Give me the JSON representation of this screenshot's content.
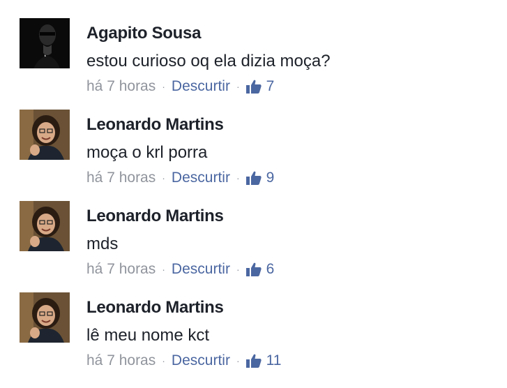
{
  "colors": {
    "text": "#1d2129",
    "meta_gray": "#90949c",
    "link_blue": "#4b67a1"
  },
  "comments": [
    {
      "author": "Agapito Sousa",
      "text": "estou curioso oq ela dizia moça?",
      "time": "há 7 horas",
      "action": "Descurtir",
      "separator": "·",
      "likes": "7",
      "avatar_icon": "dark-profile-photo"
    },
    {
      "author": "Leonardo Martins",
      "text": "moça o krl porra",
      "time": "há 7 horas",
      "action": "Descurtir",
      "separator": "·",
      "likes": "9",
      "avatar_icon": "profile-photo"
    },
    {
      "author": "Leonardo Martins",
      "text": "mds",
      "time": "há 7 horas",
      "action": "Descurtir",
      "separator": "·",
      "likes": "6",
      "avatar_icon": "profile-photo"
    },
    {
      "author": "Leonardo Martins",
      "text": "lê meu nome kct",
      "time": "há 7 horas",
      "action": "Descurtir",
      "separator": "·",
      "likes": "11",
      "avatar_icon": "profile-photo"
    }
  ]
}
